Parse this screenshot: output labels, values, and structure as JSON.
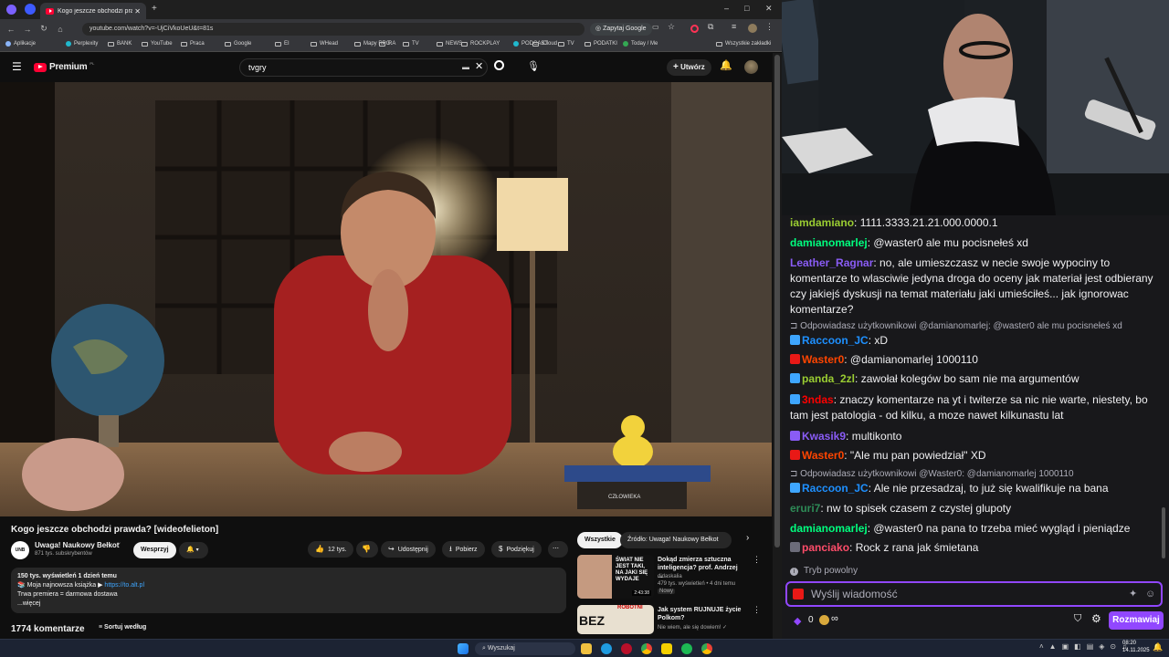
{
  "browser": {
    "tab_title": "Kogo jeszcze obchodzi prawda?",
    "url": "youtube.com/watch?v=-UjCiVkoUeU&t=81s",
    "ask_google": "Zapytaj Google",
    "bookmarks": [
      "Aplikacje",
      "Perplexity",
      "BANK",
      "YouTube",
      "Praca",
      "Google",
      "EI",
      "WHead",
      "Mapy RPG",
      "RA",
      "TV",
      "NEWS",
      "ROCKPLAY",
      "PODCAST",
      "iCloud",
      "TV",
      "PODATKI",
      "Today / Me"
    ],
    "all_bookmarks": "Wszystkie zakładki"
  },
  "youtube": {
    "logo_text": "Premium",
    "logo_sup": "PL",
    "search_value": "tvgry",
    "create_label": "Utwórz",
    "video": {
      "book_title": "CZŁOWIEKA"
    },
    "title": "Kogo jeszcze obchodzi prawda? [wideofelieton]",
    "channel": {
      "avatar_text": "UNB",
      "name": "Uwaga! Naukowy Bełkot",
      "subs": "871 tys. subskrybentów",
      "support_label": "Wesprzyj"
    },
    "actions": {
      "likes": "12 tys.",
      "share": "Udostępnij",
      "download": "Pobierz",
      "thanks": "Podziękuj"
    },
    "description": {
      "stats": "150 tys. wyświetleń  1 dzień temu",
      "line1_prefix": "📚 Moja najnowsza książka ▶ ",
      "line1_link": "https://to.alt.pl",
      "line2": "Trwa premiera = darmowa dostawa",
      "more": "...więcej"
    },
    "comments": {
      "count": "1774 komentarze",
      "sort_label": "Sortuj według"
    },
    "rec_chips": [
      "Wszystkie",
      "Źródło: Uwaga! Naukowy Bełkot"
    ],
    "recommendations": [
      {
        "thumb_text": "ŚWIAT NIE JEST TAKI, NA JAKI SIĘ WYDAJE",
        "duration": "2:43:38",
        "title": "Dokąd zmierza sztuczna inteligencja? prof. Andrzej ...",
        "channel": "didaskalia",
        "meta": "479 tys. wyświetleń • 4 dni temu",
        "badge": "Nowy"
      },
      {
        "thumb_text": "BEZ",
        "thumb_text2": "ROBOTNI",
        "title": "Jak system RUJNUJE życie Polkom?",
        "channel": "Nie wiem, ale się dowiem! ✓"
      }
    ]
  },
  "chat": {
    "messages": [
      {
        "user": "iamdamiano",
        "color": "#9acd32",
        "text": "1111.3333.21.21.000.0000.1"
      },
      {
        "user": "damianomarlej",
        "color": "#00ff7f",
        "text": "@waster0 ale mu pocisnełeś xd"
      },
      {
        "user": "Leather_Ragnar",
        "color": "#8a5cf6",
        "text": "no, ale umieszczasz w necie swoje wypociny to komentarze to wlasciwie jedyna droga do oceny jak materiał jest odbierany czy jakiejś dyskusji na temat materiału jaki umieściłeś... jak ignorowac komentarze?"
      },
      {
        "reply": "Odpowiadasz użytkownikowi @damianomarlej: @waster0 ale mu pocisnełeś xd"
      },
      {
        "user": "Raccoon_JC",
        "color": "#1e90ff",
        "text": "xD"
      },
      {
        "user": "Waster0",
        "color": "#ff4500",
        "text": "@damianomarlej 1000110"
      },
      {
        "user": "panda_2zl",
        "color": "#9acd32",
        "text": "zawołał kolegów bo sam nie ma argumentów"
      },
      {
        "user": "3ndas",
        "color": "#ff0000",
        "text": "znaczy komentarze na yt i twiterze sa nic nie warte, niestety, bo tam jest patologia - od kilku, a moze nawet kilkunastu lat"
      },
      {
        "user": "Kwasik9",
        "color": "#8a5cf6",
        "text": "multikonto"
      },
      {
        "user": "Waster0",
        "color": "#ff4500",
        "text": "\"Ale mu pan powiedział\" XD"
      },
      {
        "reply": "Odpowiadasz użytkownikowi @Waster0: @damianomarlej 1000110"
      },
      {
        "user": "Raccoon_JC",
        "color": "#1e90ff",
        "text": "Ale nie przesadzaj, to już się kwalifikuje na bana"
      },
      {
        "user": "eruri7",
        "color": "#2e8b57",
        "text": "nw to spisek czasem z czystej glupoty"
      },
      {
        "user": "damianomarlej",
        "color": "#00ff7f",
        "text": "@waster0 na pana to trzeba mieć wygląd i pieniądze"
      },
      {
        "user": "panciako",
        "color": "#ff4d6a",
        "text": "Rock z rana jak śmietana"
      }
    ],
    "slow_mode": "Tryb powolny",
    "input_placeholder": "Wyślij wiadomość",
    "points": "0",
    "send_label": "Rozmawiaj"
  },
  "taskbar": {
    "search": "Wyszukaj",
    "time": "08:20",
    "date": "14.11.2025"
  }
}
